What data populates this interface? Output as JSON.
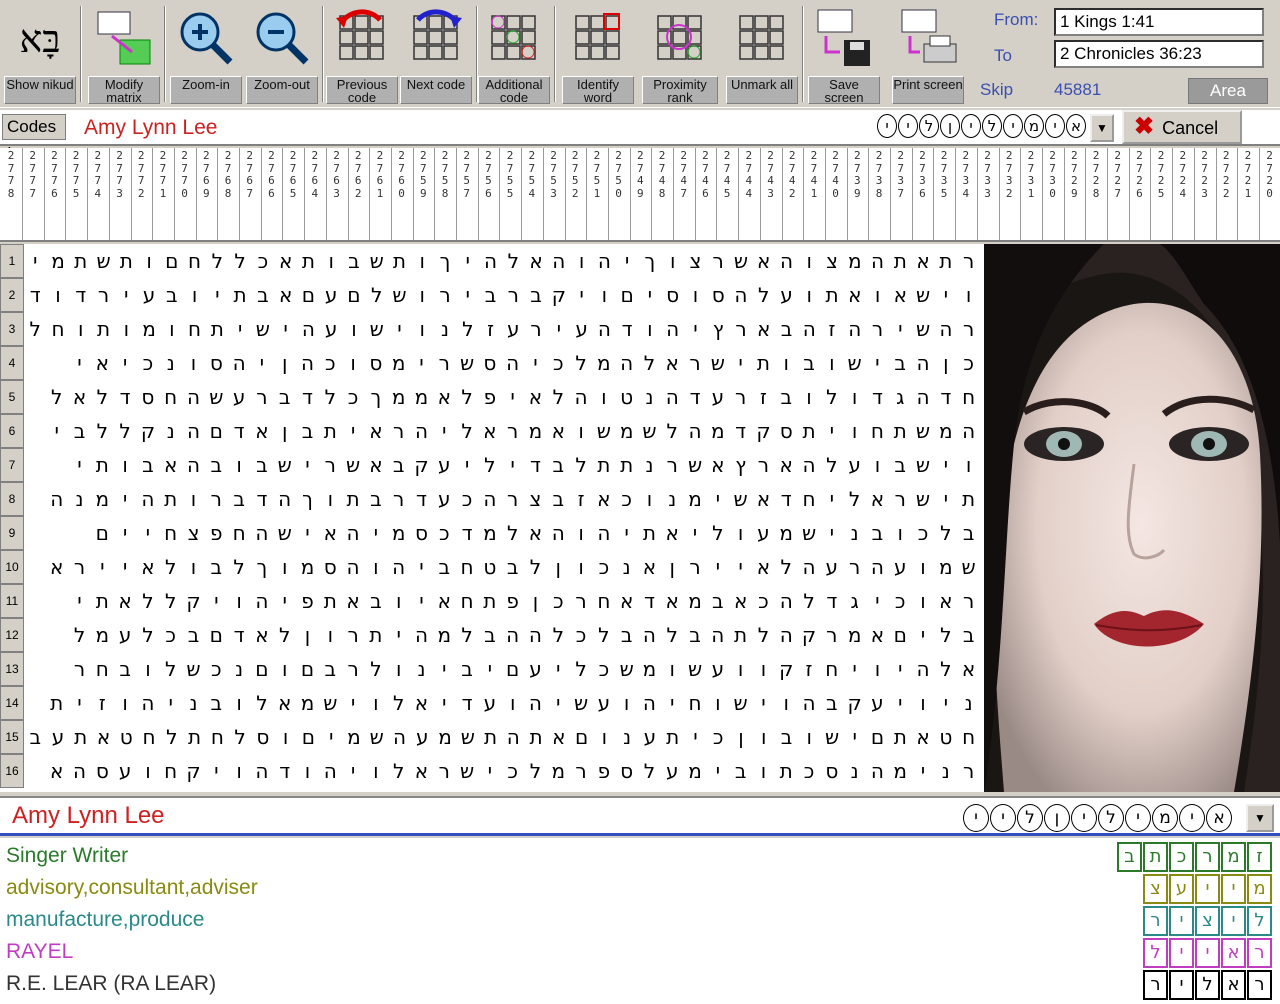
{
  "toolbar": {
    "buttons": [
      {
        "id": "show-nikud",
        "label": "Show nikud",
        "icon": "hebrew-letters-icon"
      },
      {
        "id": "modify-matrix",
        "label": "Modify matrix",
        "icon": "matrix-resize-icon"
      },
      {
        "id": "zoom-in",
        "label": "Zoom-in",
        "icon": "zoom-in-icon"
      },
      {
        "id": "zoom-out",
        "label": "Zoom-out",
        "icon": "zoom-out-icon"
      },
      {
        "id": "previous-code",
        "label": "Previous code",
        "icon": "previous-arrow-icon"
      },
      {
        "id": "next-code",
        "label": "Next code",
        "icon": "next-arrow-icon"
      },
      {
        "id": "additional-code",
        "label": "Additional code",
        "icon": "additional-code-icon"
      },
      {
        "id": "identify-word",
        "label": "Identify word",
        "icon": "identify-word-icon"
      },
      {
        "id": "proximity-rank",
        "label": "Proximity rank",
        "icon": "proximity-icon"
      },
      {
        "id": "unmark-all",
        "label": "Unmark all",
        "icon": "unmark-icon"
      },
      {
        "id": "save-screen",
        "label": "Save screen",
        "icon": "save-disk-icon"
      },
      {
        "id": "print-screen",
        "label": "Print screen",
        "icon": "printer-icon"
      }
    ],
    "from_label": "From:",
    "from_value": "1 Kings 1:41",
    "to_label": "To",
    "to_value": "2 Chronicles 36:23",
    "skip_label": "Skip",
    "skip_value": "45881",
    "area_label": "Area"
  },
  "codes": {
    "label": "Codes :",
    "value": "Amy Lynn Lee",
    "hebrew_letters": [
      "א",
      "י",
      "מ",
      "י",
      "ל",
      "י",
      "ן",
      "ל",
      "י",
      "י"
    ],
    "cancel_label": "Cancel"
  },
  "column_headers": [
    "2778",
    "2777",
    "2776",
    "2775",
    "2774",
    "2773",
    "2772",
    "2771",
    "2770",
    "2769",
    "2768",
    "2767",
    "2766",
    "2765",
    "2764",
    "2763",
    "2762",
    "2761",
    "2760",
    "2759",
    "2758",
    "2757",
    "2756",
    "2755",
    "2754",
    "2753",
    "2752",
    "2751",
    "2750",
    "2749",
    "2748",
    "2747",
    "2746",
    "2745",
    "2744",
    "2743",
    "2742",
    "2741",
    "2740",
    "2739",
    "2738",
    "2737",
    "2736",
    "2735",
    "2734",
    "2733",
    "2732",
    "2731",
    "2730",
    "2729",
    "2728",
    "2727",
    "2726",
    "2725",
    "2724",
    "2723",
    "2722",
    "2721",
    "2720"
  ],
  "rows": [
    "רתאתהמצוהאשרצוךיהוהאלהיךותשבותאכללחםותשתמי",
    "וישאואתועלהסוסיםויקברבירושלםעםאבתיובעירדוד",
    "רהשירהזהבארץיהודהעירעזלנוישועהישיתחומותוחל",
    "כןהבישובותישראלהמלכיהסשרימסוכהןיהסונכיאי",
    "חדהגדולובזרעדהנטוהלאיפלאממךכלדברעשהחסדלאל",
    "המשתחויתסקדמהלשמשואמראליהראיתבןאדםהנקללבי",
    "וישבועלהארץאשרנתתלבדיליעקבאשרישבובהאבותי",
    "תישראליחדאשימנוכאזבצרהכעדרבתוךהדברותהימנה",
    "בלכובנישמעוליאתיהוהאלמדכסמיהאישהחפצחיים",
    "שמועהרעהלאיירןאנכוןלבטחביהוהסמוךלבולאיירא",
    "ראוכיגדלהכאבמאדאחרכןפתחאיובאתפיהויקללאתי",
    "בליםאמרקהלתהבלהבלכלההבלמהיתרוןלאדםבכלעמל",
    "אלהיויחזקוועשומשכליעםיבינולרבםוםנכשלובחר",
    "ניויעקבהוישוחיהועשיהועדיאלוישמאלובניהוזית",
    "חטאתםישובוןכיתענוםאתהתשמעהשמיםוסלחתלחטאתעב",
    "רנימהנסכתובימעלספרמלכישראלויהודהויקחועסהא"
  ],
  "portrait": {
    "alt": "portrait-photo"
  },
  "result": {
    "name": "Amy Lynn Lee",
    "hebrew_letters": [
      "א",
      "י",
      "מ",
      "י",
      "ל",
      "י",
      "ן",
      "ל",
      "י",
      "י"
    ],
    "definitions": [
      {
        "text": "Singer Writer",
        "color": "#2a7a2a",
        "letters": [
          "ז",
          "מ",
          "ר",
          "כ",
          "ת",
          "ב"
        ],
        "box": "#2a7a2a"
      },
      {
        "text": "advisory,consultant,adviser",
        "color": "#8a8a10",
        "letters": [
          "מ",
          "י",
          "י",
          "ע",
          "צ"
        ],
        "box": "#8a8a10"
      },
      {
        "text": "manufacture,produce",
        "color": "#2a8a8a",
        "letters": [
          "ל",
          "י",
          "צ",
          "י",
          "ר"
        ],
        "box": "#2a8a8a"
      },
      {
        "text": "RAYEL",
        "color": "#c03cc0",
        "letters": [
          "ר",
          "א",
          "י",
          "י",
          "ל"
        ],
        "box": "#c03cc0"
      },
      {
        "text": "R.E. LEAR (RA LEAR)",
        "color": "#333333",
        "letters": [
          "ר",
          "א",
          "ל",
          "י",
          "ר"
        ],
        "box": "#000000"
      }
    ]
  }
}
